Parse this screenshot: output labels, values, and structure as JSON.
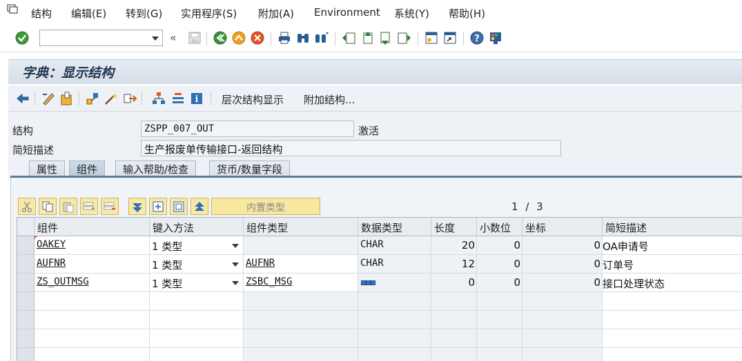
{
  "menubar": {
    "items": [
      "结构",
      "编辑(E)",
      "转到(G)",
      "实用程序(S)",
      "附加(A)",
      "Environment",
      "系统(Y)",
      "帮助(H)"
    ]
  },
  "toolbar": {
    "command_field_value": "",
    "back_glyph": "«",
    "icons": [
      "check-icon",
      "save-icon",
      "back-icon",
      "exit-icon",
      "cancel-icon",
      "print-icon",
      "find-icon",
      "find-next-icon",
      "first-page-icon",
      "prev-page-icon",
      "next-page-icon",
      "last-page-icon",
      "new-session-icon",
      "shortcut-icon",
      "help-icon",
      "customize-layout-icon"
    ]
  },
  "title": "字典：显示结构",
  "app_toolbar": {
    "hierarchy_label": "层次结构显示",
    "append_label": "附加结构..."
  },
  "form": {
    "structure_label": "结构",
    "structure_value": "ZSPP_007_OUT",
    "status": "激活",
    "short_desc_label": "简短描述",
    "short_desc_value": "生产报废单传输接口-返回结构"
  },
  "tabs": [
    "属性",
    "组件",
    "输入帮助/检查",
    "货币/数量字段"
  ],
  "active_tab": "组件",
  "table_toolbar": {
    "builtin_type_label": "内置类型",
    "page_current": "1",
    "page_sep": "/",
    "page_total": "3"
  },
  "table": {
    "headers": [
      "组件",
      "键入方法",
      "组件类型",
      "数据类型",
      "长度",
      "小数位",
      "坐标",
      "简短描述"
    ],
    "rows": [
      {
        "component": "OAKEY",
        "typing": "1 类型",
        "comp_type": "",
        "data_type": "CHAR",
        "length": "20",
        "decimals": "0",
        "coord": "0",
        "desc": "OA申请号"
      },
      {
        "component": "AUFNR",
        "typing": "1 类型",
        "comp_type": "AUFNR",
        "data_type": "CHAR",
        "length": "12",
        "decimals": "0",
        "coord": "0",
        "desc": "订单号"
      },
      {
        "component": "ZS_OUTMSG",
        "typing": "1 类型",
        "comp_type": "ZSBC_MSG",
        "data_type": "",
        "length": "0",
        "decimals": "0",
        "coord": "0",
        "desc": "接口处理状态"
      }
    ]
  },
  "colors": {
    "title_bar": "#d6dee8",
    "tab_accent": "#5b7b9c",
    "table_button": "#f7e9a7"
  }
}
